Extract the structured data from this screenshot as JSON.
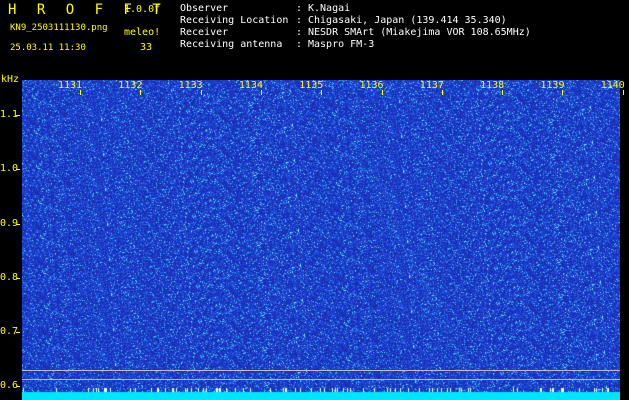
{
  "header": {
    "app_name": "H R O F F T",
    "version": "1.0.0f",
    "file_name": "KN9_2503111130.png",
    "mode_label": "meleo!",
    "timestamp": "25.03.11 11:30",
    "count": "33"
  },
  "info": [
    {
      "label": "Observer",
      "sep": ":",
      "value": "K.Nagai"
    },
    {
      "label": "Receiving Location",
      "sep": ":",
      "value": "Chigasaki, Japan (139.414 35.340)"
    },
    {
      "label": "Receiver",
      "sep": ":",
      "value": "NESDR SMArt (Miakejima VOR 108.65MHz)"
    },
    {
      "label": "Receiving antenna",
      "sep": ":",
      "value": "Maspro FM-3"
    }
  ],
  "chart_data": {
    "type": "heatmap",
    "y_unit": "kHz",
    "x_ticks": [
      "1131",
      "1132",
      "1133",
      "1134",
      "1135",
      "1136",
      "1137",
      "1138",
      "1139",
      "1140"
    ],
    "y_ticks": [
      "1.1",
      "1.0",
      "0.9",
      "0.8",
      "0.7",
      "0.6"
    ],
    "y_values": [
      1.1,
      1.0,
      0.9,
      0.8,
      0.7,
      0.6
    ],
    "ylim": [
      0.575,
      1.165
    ],
    "colors": {
      "background": "#1a2fb5",
      "noise": "#2a5ee8",
      "signal": "#39e0ff",
      "baseline": "#00e5ff"
    }
  }
}
